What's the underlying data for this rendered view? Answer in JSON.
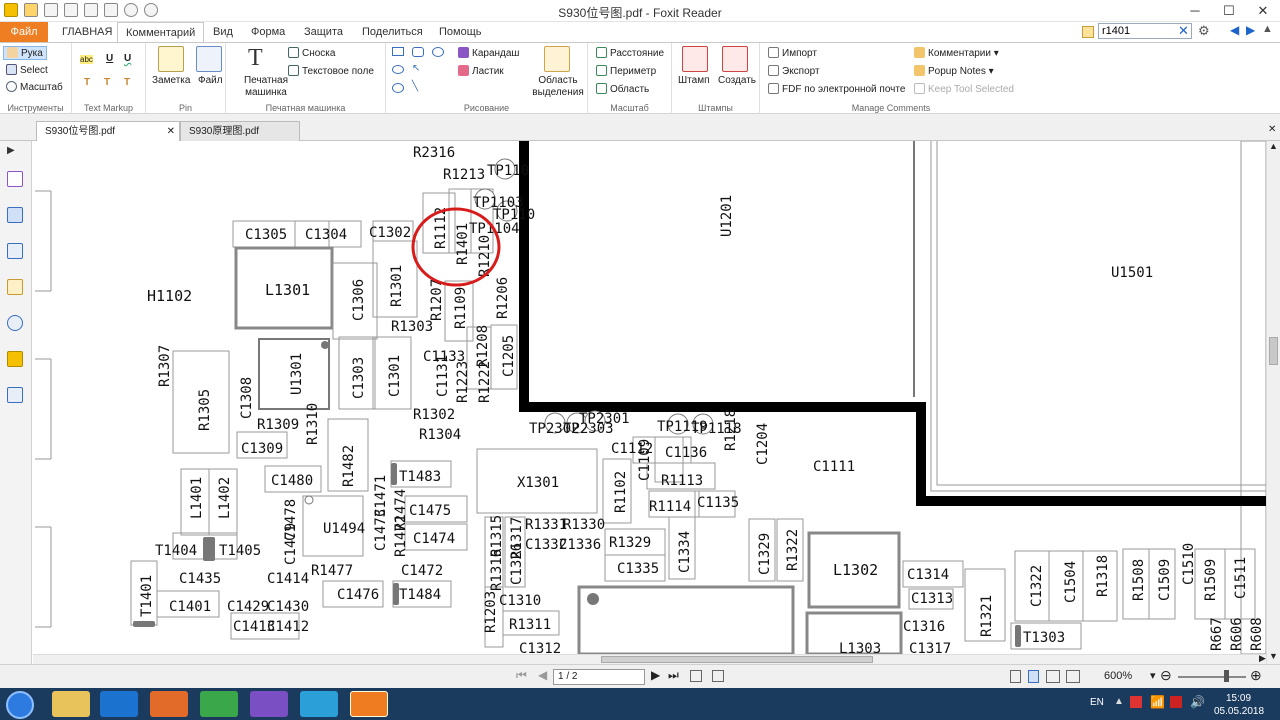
{
  "window": {
    "title": "S930位号图.pdf - Foxit Reader",
    "search_value": "r1401"
  },
  "menu": [
    "Файл",
    "ГЛАВНАЯ",
    "Комментарий",
    "Вид",
    "Форма",
    "Защита",
    "Поделиться",
    "Помощь"
  ],
  "ribbon": {
    "tools": {
      "hand": "Рука",
      "select": "Select",
      "zoom": "Масштаб",
      "label": "Инструменты"
    },
    "markup": {
      "label": "Text Markup",
      "t1": "abc",
      "t2": "U",
      "t3": "U",
      "t4": "T",
      "t5": "T",
      "t6": "T"
    },
    "pin": {
      "note": "Заметка",
      "file": "Файл",
      "label": "Pin"
    },
    "typewriter": {
      "tw": "Печатная машинка",
      "callout": "Сноска",
      "textbox": "Текстовое поле",
      "label": "Печатная машинка"
    },
    "drawing": {
      "pencil": "Карандаш",
      "eraser": "Ластик",
      "area": "Область выделения",
      "label": "Рисование"
    },
    "measure": {
      "distance": "Расстояние",
      "perimeter": "Периметр",
      "area": "Область",
      "label": "Масштаб"
    },
    "stamps": {
      "stamp": "Штамп",
      "create": "Создать",
      "label": "Штампы"
    },
    "manage": {
      "import": "Импорт",
      "export": "Экспорт",
      "fdf": "FDF по электронной почте",
      "comments": "Комментарии",
      "popup": "Popup Notes",
      "keep": "Keep Tool Selected",
      "label": "Manage Comments"
    }
  },
  "doc_tabs": [
    "S930位号图.pdf",
    "S930原理图.pdf"
  ],
  "pcb": {
    "labels": [
      "R2316",
      "R1213",
      "TP110",
      "TP1103",
      "TP110",
      "C1305",
      "C1304",
      "C1302",
      "R1112",
      "R1401",
      "R1210",
      "TP1104",
      "H1102",
      "L1301",
      "C1306",
      "R1301",
      "R1207",
      "R1109",
      "R1206",
      "R1303",
      "U1201",
      "U1501",
      "R1307",
      "U1301",
      "C1303",
      "C1301",
      "C1133",
      "R1208",
      "C1205",
      "R1305",
      "C1308",
      "C1131",
      "R1223",
      "R1222",
      "R1309",
      "R1310",
      "R1302",
      "R1304",
      "TP2302",
      "TP2301",
      "TP2303",
      "TP1119",
      "TP1118",
      "R1218",
      "C1309",
      "C1112",
      "C1109",
      "C1136",
      "C1204",
      "C1111",
      "L1401",
      "L1402",
      "C1480",
      "R1482",
      "T1483",
      "X1301",
      "R1113",
      "R1114",
      "C1135",
      "C1478",
      "C1471",
      "R1474",
      "C1475",
      "U1494",
      "C1473",
      "R1472",
      "C1474",
      "R1102",
      "R1315",
      "R1317",
      "R1331",
      "R1330",
      "C1332",
      "C1336",
      "R1329",
      "C1334",
      "C1329",
      "R1322",
      "L1302",
      "C1314",
      "C1322",
      "C1504",
      "R1318",
      "R1508",
      "C1509",
      "C1510",
      "R1509",
      "C1511",
      "T1404",
      "T1405",
      "C1479",
      "C1414",
      "R1477",
      "C1472",
      "C1435",
      "T1401",
      "C1401",
      "C1429",
      "C1430",
      "C1413",
      "C1412",
      "C1476",
      "T1484",
      "R1316",
      "C1326",
      "C1310",
      "R1203",
      "R1311",
      "C1335",
      "C1313",
      "C1316",
      "C1317",
      "R1321",
      "T1303",
      "R667",
      "R606",
      "R608",
      "L1303",
      "C1312"
    ]
  },
  "status": {
    "page": "1 / 2",
    "zoom": "600%"
  },
  "taskbar": {
    "lang": "EN",
    "time": "15:09",
    "date": "05.05.2018"
  }
}
